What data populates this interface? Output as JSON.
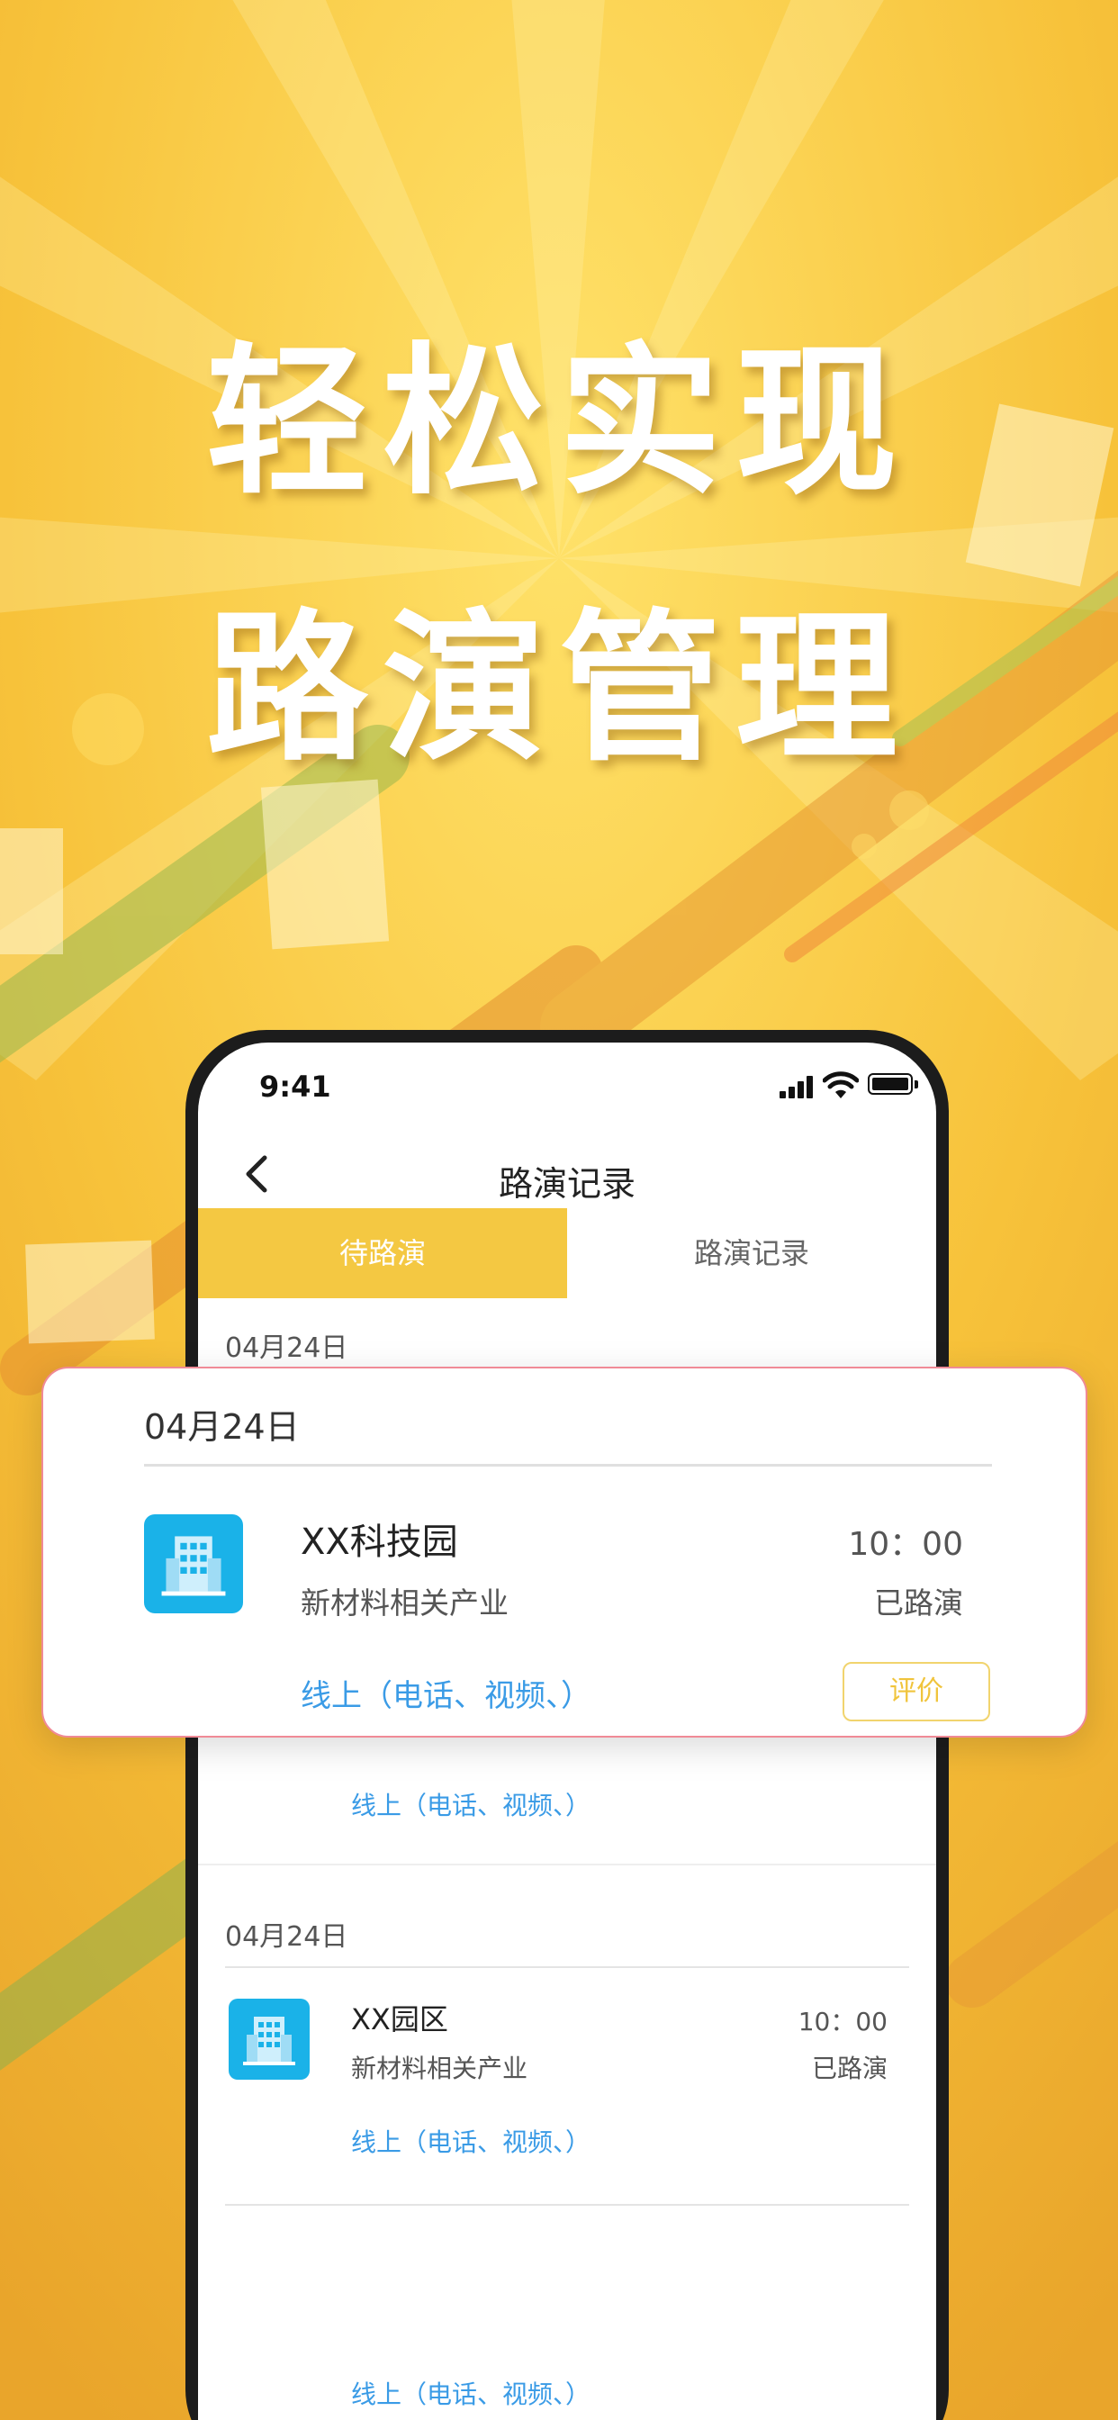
{
  "headline": {
    "line1": "轻松实现",
    "line2": "路演管理"
  },
  "status_bar": {
    "time": "9:41"
  },
  "nav": {
    "title": "路演记录"
  },
  "tabs": [
    {
      "label": "待路演",
      "active": true
    },
    {
      "label": "路演记录",
      "active": false
    }
  ],
  "records": [
    {
      "date": "04月24日",
      "link": "线上（电话、视频、）"
    },
    {
      "date": "04月24日",
      "title": "XX园区",
      "subtitle": "新材料相关产业",
      "time": "10：00",
      "status": "已路演",
      "link": "线上（电话、视频、）"
    },
    {
      "link": "线上（电话、视频、）"
    }
  ],
  "popup_card": {
    "date": "04月24日",
    "title": "XX科技园",
    "subtitle": "新材料相关产业",
    "time": "10：00",
    "status": "已路演",
    "link": "线上（电话、视频、）",
    "button": "评价"
  },
  "colors": {
    "accent": "#f4c842",
    "link": "#3a9be6",
    "icon_tile": "#1ab2e8",
    "card_border": "#f08a96"
  }
}
